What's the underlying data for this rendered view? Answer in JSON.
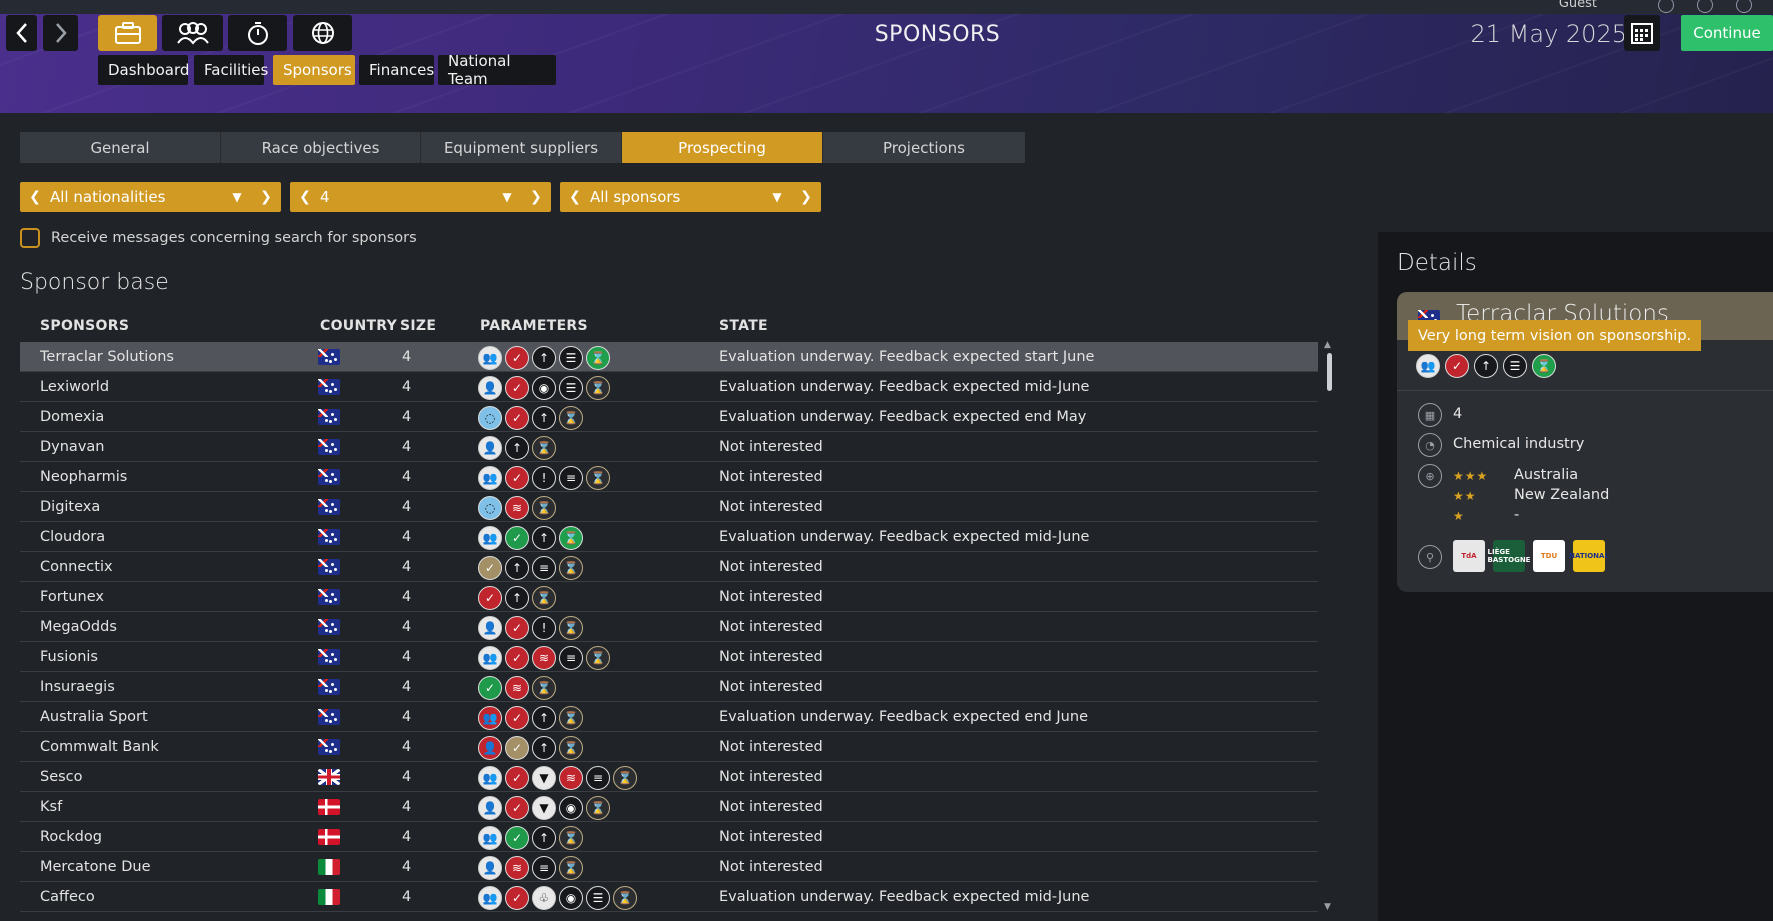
{
  "header": {
    "guest_label": "Guest",
    "title": "SPONSORS",
    "date": "21 May 2025",
    "continue_label": "Continue"
  },
  "subnav": [
    "Dashboard",
    "Facilities",
    "Sponsors",
    "Finances",
    "National Team"
  ],
  "tabs": [
    "General",
    "Race objectives",
    "Equipment suppliers",
    "Prospecting",
    "Projections"
  ],
  "filters": {
    "nationality": "All nationalities",
    "size": "4",
    "sponsors": "All sponsors"
  },
  "checkbox_label": "Receive messages concerning search for sponsors",
  "section_title": "Sponsor base",
  "columns": {
    "sponsors": "SPONSORS",
    "country": "COUNTRY",
    "size": "SIZE",
    "parameters": "PARAMETERS",
    "state": "STATE"
  },
  "rows": [
    {
      "name": "Terraclar Solutions",
      "flag": "au",
      "size": "4",
      "state": "Evaluation underway. Feedback expected start June",
      "params": [
        "people",
        "shoe-red",
        "up-dark",
        "doc",
        "hour-green"
      ]
    },
    {
      "name": "Lexiworld",
      "flag": "au",
      "size": "4",
      "state": "Evaluation underway. Feedback expected mid-June",
      "params": [
        "person",
        "shoe-red",
        "fire-dark",
        "doc",
        "hour"
      ]
    },
    {
      "name": "Domexia",
      "flag": "au",
      "size": "4",
      "state": "Evaluation underway. Feedback expected end May",
      "params": [
        "globe",
        "shoe-red",
        "up-dark",
        "hour"
      ]
    },
    {
      "name": "Dynavan",
      "flag": "au",
      "size": "4",
      "state": "Not interested",
      "params": [
        "person",
        "up-dark",
        "hour"
      ]
    },
    {
      "name": "Neopharmis",
      "flag": "au",
      "size": "4",
      "state": "Not interested",
      "params": [
        "people",
        "shoe-red",
        "alert-dark",
        "doc2",
        "hour"
      ]
    },
    {
      "name": "Digitexa",
      "flag": "au",
      "size": "4",
      "state": "Not interested",
      "params": [
        "globe",
        "speed-red",
        "hour"
      ]
    },
    {
      "name": "Cloudora",
      "flag": "au",
      "size": "4",
      "state": "Evaluation underway. Feedback expected mid-June",
      "params": [
        "people",
        "shoe-green",
        "up-dark",
        "hour-green"
      ]
    },
    {
      "name": "Connectix",
      "flag": "au",
      "size": "4",
      "state": "Not interested",
      "params": [
        "shoe-tan",
        "up-dark",
        "doc2",
        "hour"
      ]
    },
    {
      "name": "Fortunex",
      "flag": "au",
      "size": "4",
      "state": "Not interested",
      "params": [
        "shoe-red",
        "up-dark",
        "hour"
      ]
    },
    {
      "name": "MegaOdds",
      "flag": "au",
      "size": "4",
      "state": "Not interested",
      "params": [
        "person",
        "shoe-red",
        "alert-dark",
        "hour"
      ]
    },
    {
      "name": "Fusionis",
      "flag": "au",
      "size": "4",
      "state": "Not interested",
      "params": [
        "people",
        "shoe-red",
        "speed-red",
        "doc2",
        "hour"
      ]
    },
    {
      "name": "Insuraegis",
      "flag": "au",
      "size": "4",
      "state": "Not interested",
      "params": [
        "shoe-green",
        "speed-red",
        "hour"
      ]
    },
    {
      "name": "Australia Sport",
      "flag": "au",
      "size": "4",
      "state": "Evaluation underway. Feedback expected end June",
      "params": [
        "people-red",
        "shoe-red",
        "up-dark",
        "hour"
      ]
    },
    {
      "name": "Commwalt Bank",
      "flag": "au",
      "size": "4",
      "state": "Not interested",
      "params": [
        "person-red",
        "shoe-tan",
        "up-dark",
        "hour"
      ]
    },
    {
      "name": "Sesco",
      "flag": "gb",
      "size": "4",
      "state": "Not interested",
      "params": [
        "people",
        "shoe-red",
        "shirt",
        "speed-red",
        "doc2",
        "hour"
      ]
    },
    {
      "name": "Ksf",
      "flag": "dk",
      "size": "4",
      "state": "Not interested",
      "params": [
        "person",
        "shoe-red",
        "shirt",
        "fire-dark",
        "hour"
      ]
    },
    {
      "name": "Rockdog",
      "flag": "dk",
      "size": "4",
      "state": "Not interested",
      "params": [
        "people",
        "shoe-green",
        "up-dark",
        "hour"
      ]
    },
    {
      "name": "Mercatone Due",
      "flag": "it",
      "size": "4",
      "state": "Not interested",
      "params": [
        "person",
        "speed-red",
        "doc2",
        "hour"
      ]
    },
    {
      "name": "Caffeco",
      "flag": "it",
      "size": "4",
      "state": "Evaluation underway. Feedback expected mid-June",
      "params": [
        "people",
        "shoe-red",
        "lungs",
        "fire-dark",
        "doc",
        "hour"
      ]
    }
  ],
  "details": {
    "title": "Details",
    "sponsor_name": "Terraclar Solutions",
    "tooltip": "Very long term vision on sponsorship.",
    "size": "4",
    "industry": "Chemical industry",
    "countries": [
      {
        "name": "Australia",
        "stars": "★★★"
      },
      {
        "name": "New Zealand",
        "stars": "★★"
      },
      {
        "name": "-",
        "stars": "★"
      }
    ],
    "races": [
      {
        "label": "TdA",
        "bg": "#e7e7e7",
        "fg": "#c0242d"
      },
      {
        "label": "LIÈGE BASTOGNE",
        "bg": "#1b5e3a",
        "fg": "#ffffff"
      },
      {
        "label": "TDU",
        "bg": "#ffffff",
        "fg": "#e07a18"
      },
      {
        "label": "NATIONAL",
        "bg": "#f0c419",
        "fg": "#1d2f8a"
      }
    ]
  },
  "colors": {
    "accent": "#d19a23",
    "continue": "#2ec06a",
    "panel": "#15171b",
    "background": "#202327"
  }
}
